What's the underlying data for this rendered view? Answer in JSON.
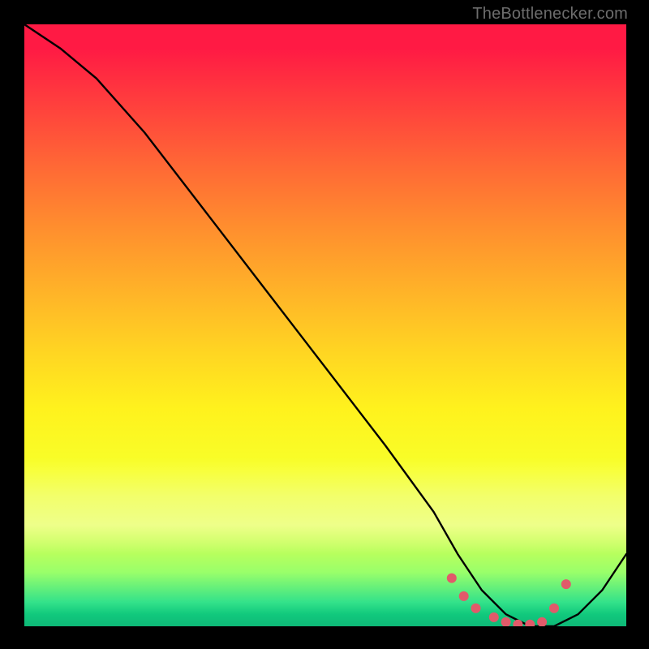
{
  "watermark": "TheBottleneсker.com",
  "chart_data": {
    "type": "line",
    "title": "",
    "xlabel": "",
    "ylabel": "",
    "xlim": [
      0,
      100
    ],
    "ylim": [
      0,
      100
    ],
    "series": [
      {
        "name": "curve",
        "x": [
          0,
          6,
          12,
          20,
          30,
          40,
          50,
          60,
          68,
          72,
          76,
          80,
          84,
          88,
          92,
          96,
          100
        ],
        "y": [
          100,
          96,
          91,
          82,
          69,
          56,
          43,
          30,
          19,
          12,
          6,
          2,
          0,
          0,
          2,
          6,
          12
        ]
      }
    ],
    "markers": {
      "name": "optimal-range-dots",
      "color": "#e15a6a",
      "points_x": [
        71,
        73,
        75,
        78,
        80,
        82,
        84,
        86,
        88,
        90
      ],
      "points_y": [
        8,
        5,
        3,
        1.5,
        0.7,
        0.3,
        0.3,
        0.7,
        3,
        7
      ]
    },
    "background_gradient": {
      "top": "#ff1a44",
      "mid": "#fff21d",
      "bottom": "#0eb877"
    }
  }
}
